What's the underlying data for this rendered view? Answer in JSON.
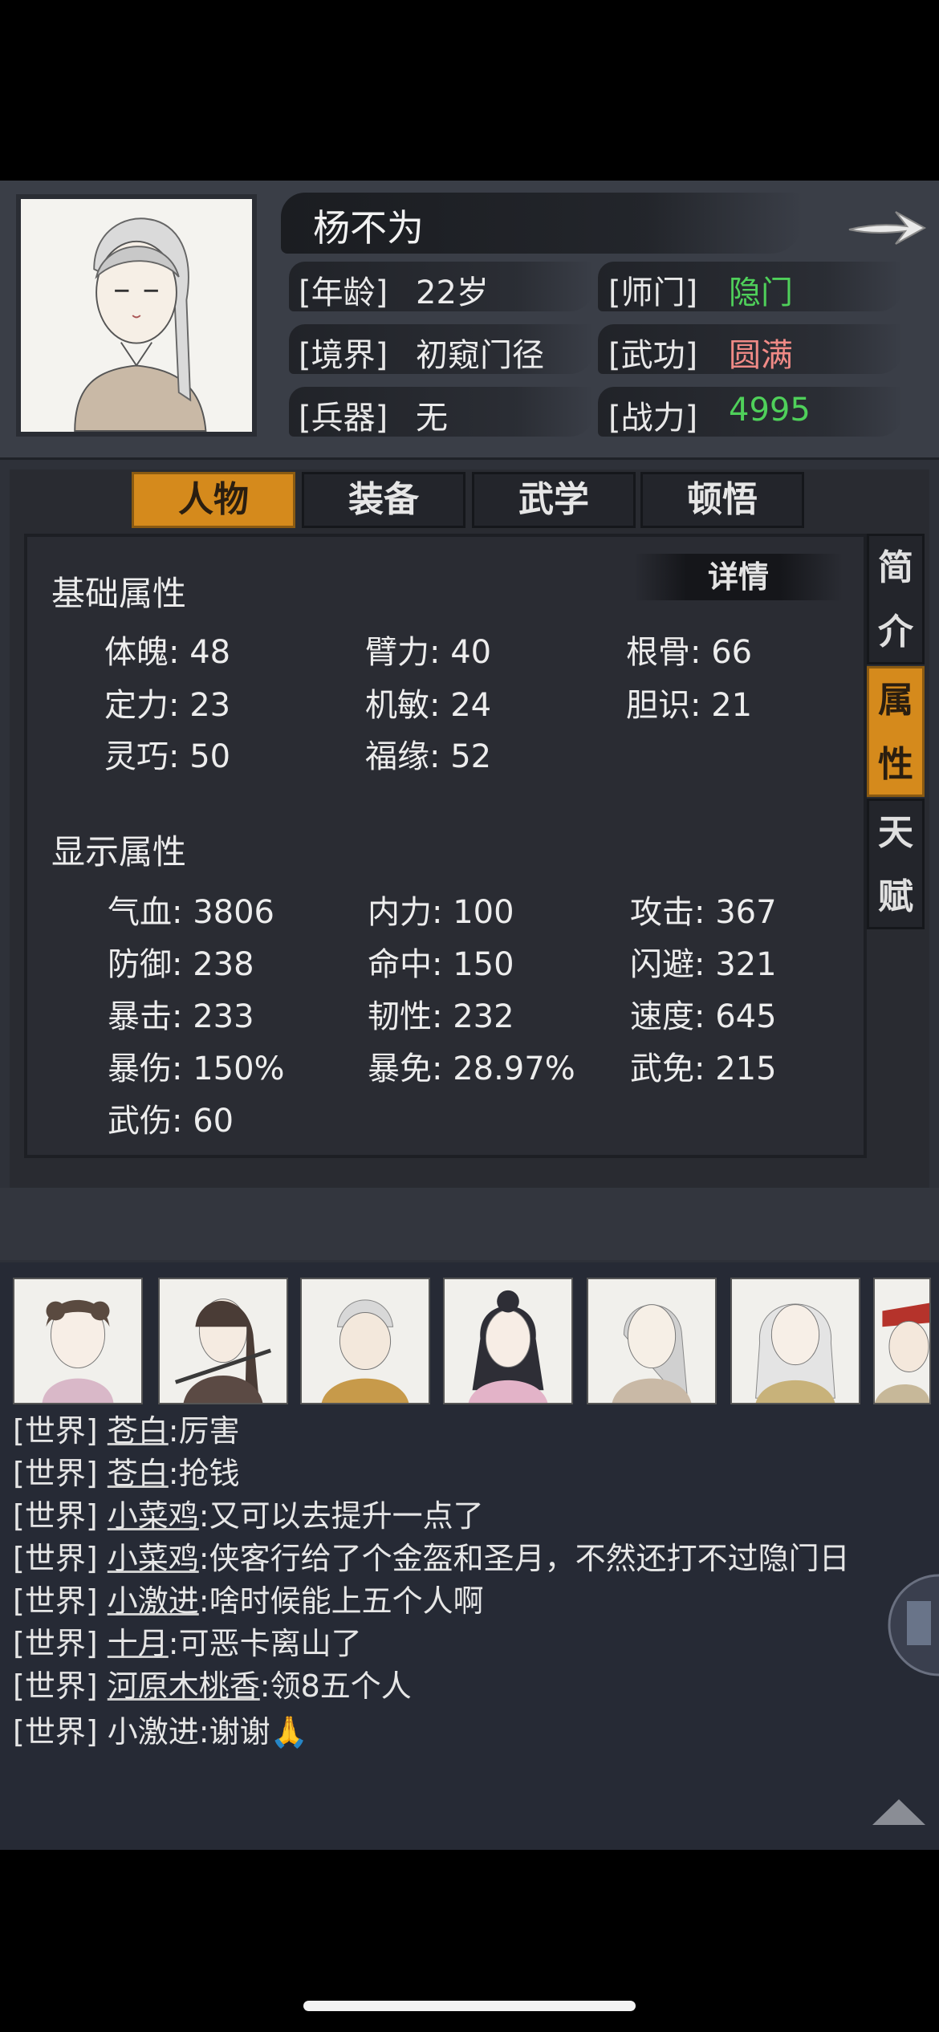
{
  "profile": {
    "name": "杨不为",
    "age_label": "[年龄]",
    "age_value": "22岁",
    "sect_label": "[师门]",
    "sect_value": "隐门",
    "realm_label": "[境界]",
    "realm_value": "初窥门径",
    "skill_label": "[武功]",
    "skill_value": "圆满",
    "weapon_label": "[兵器]",
    "weapon_value": "无",
    "power_label": "[战力]",
    "power_value": "4995",
    "colors": {
      "green": "#4fd05a",
      "red": "#f08a86"
    }
  },
  "tabs": [
    "人物",
    "装备",
    "武学",
    "顿悟"
  ],
  "side_tabs": [
    {
      "chars": [
        "简",
        "介"
      ]
    },
    {
      "chars": [
        "属",
        "性"
      ]
    },
    {
      "chars": [
        "天",
        "赋"
      ]
    }
  ],
  "attributes": {
    "detail_label": "详情",
    "basic_title": "基础属性",
    "basic": [
      {
        "label": "体魄: 48"
      },
      {
        "label": "臂力: 40"
      },
      {
        "label": "根骨: 66"
      },
      {
        "label": "定力: 23"
      },
      {
        "label": "机敏: 24"
      },
      {
        "label": "胆识: 21"
      },
      {
        "label": "灵巧: 50"
      },
      {
        "label": "福缘: 52"
      }
    ],
    "display_title": "显示属性",
    "display": [
      {
        "label": "气血: 3806"
      },
      {
        "label": "内力: 100"
      },
      {
        "label": "攻击: 367"
      },
      {
        "label": "防御: 238"
      },
      {
        "label": "命中: 150"
      },
      {
        "label": "闪避: 321"
      },
      {
        "label": "暴击: 233"
      },
      {
        "label": "韧性: 232"
      },
      {
        "label": "速度: 645"
      },
      {
        "label": "暴伤: 150%"
      },
      {
        "label": "暴免: 28.97%"
      },
      {
        "label": "武免: 215"
      },
      {
        "label": "武伤: 60"
      }
    ]
  },
  "chat": {
    "channel": "[世界]",
    "messages": [
      {
        "user": "苍白",
        "text": ":厉害"
      },
      {
        "user": "苍白",
        "text": ":抢钱"
      },
      {
        "user": "小菜鸡",
        "text": ":又可以去提升一点了"
      },
      {
        "user": "小菜鸡",
        "text": ":侠客行给了个金盔和圣月，不然还打不过隐门日"
      },
      {
        "user": "小激进",
        "text": ":啥时候能上五个人啊"
      },
      {
        "user": "十月",
        "text": ":可恶卡离山了"
      },
      {
        "user": "河原木桃香",
        "text": ":领8五个人"
      },
      {
        "user": "小激进",
        "text": ":谢谢🙏"
      }
    ]
  }
}
